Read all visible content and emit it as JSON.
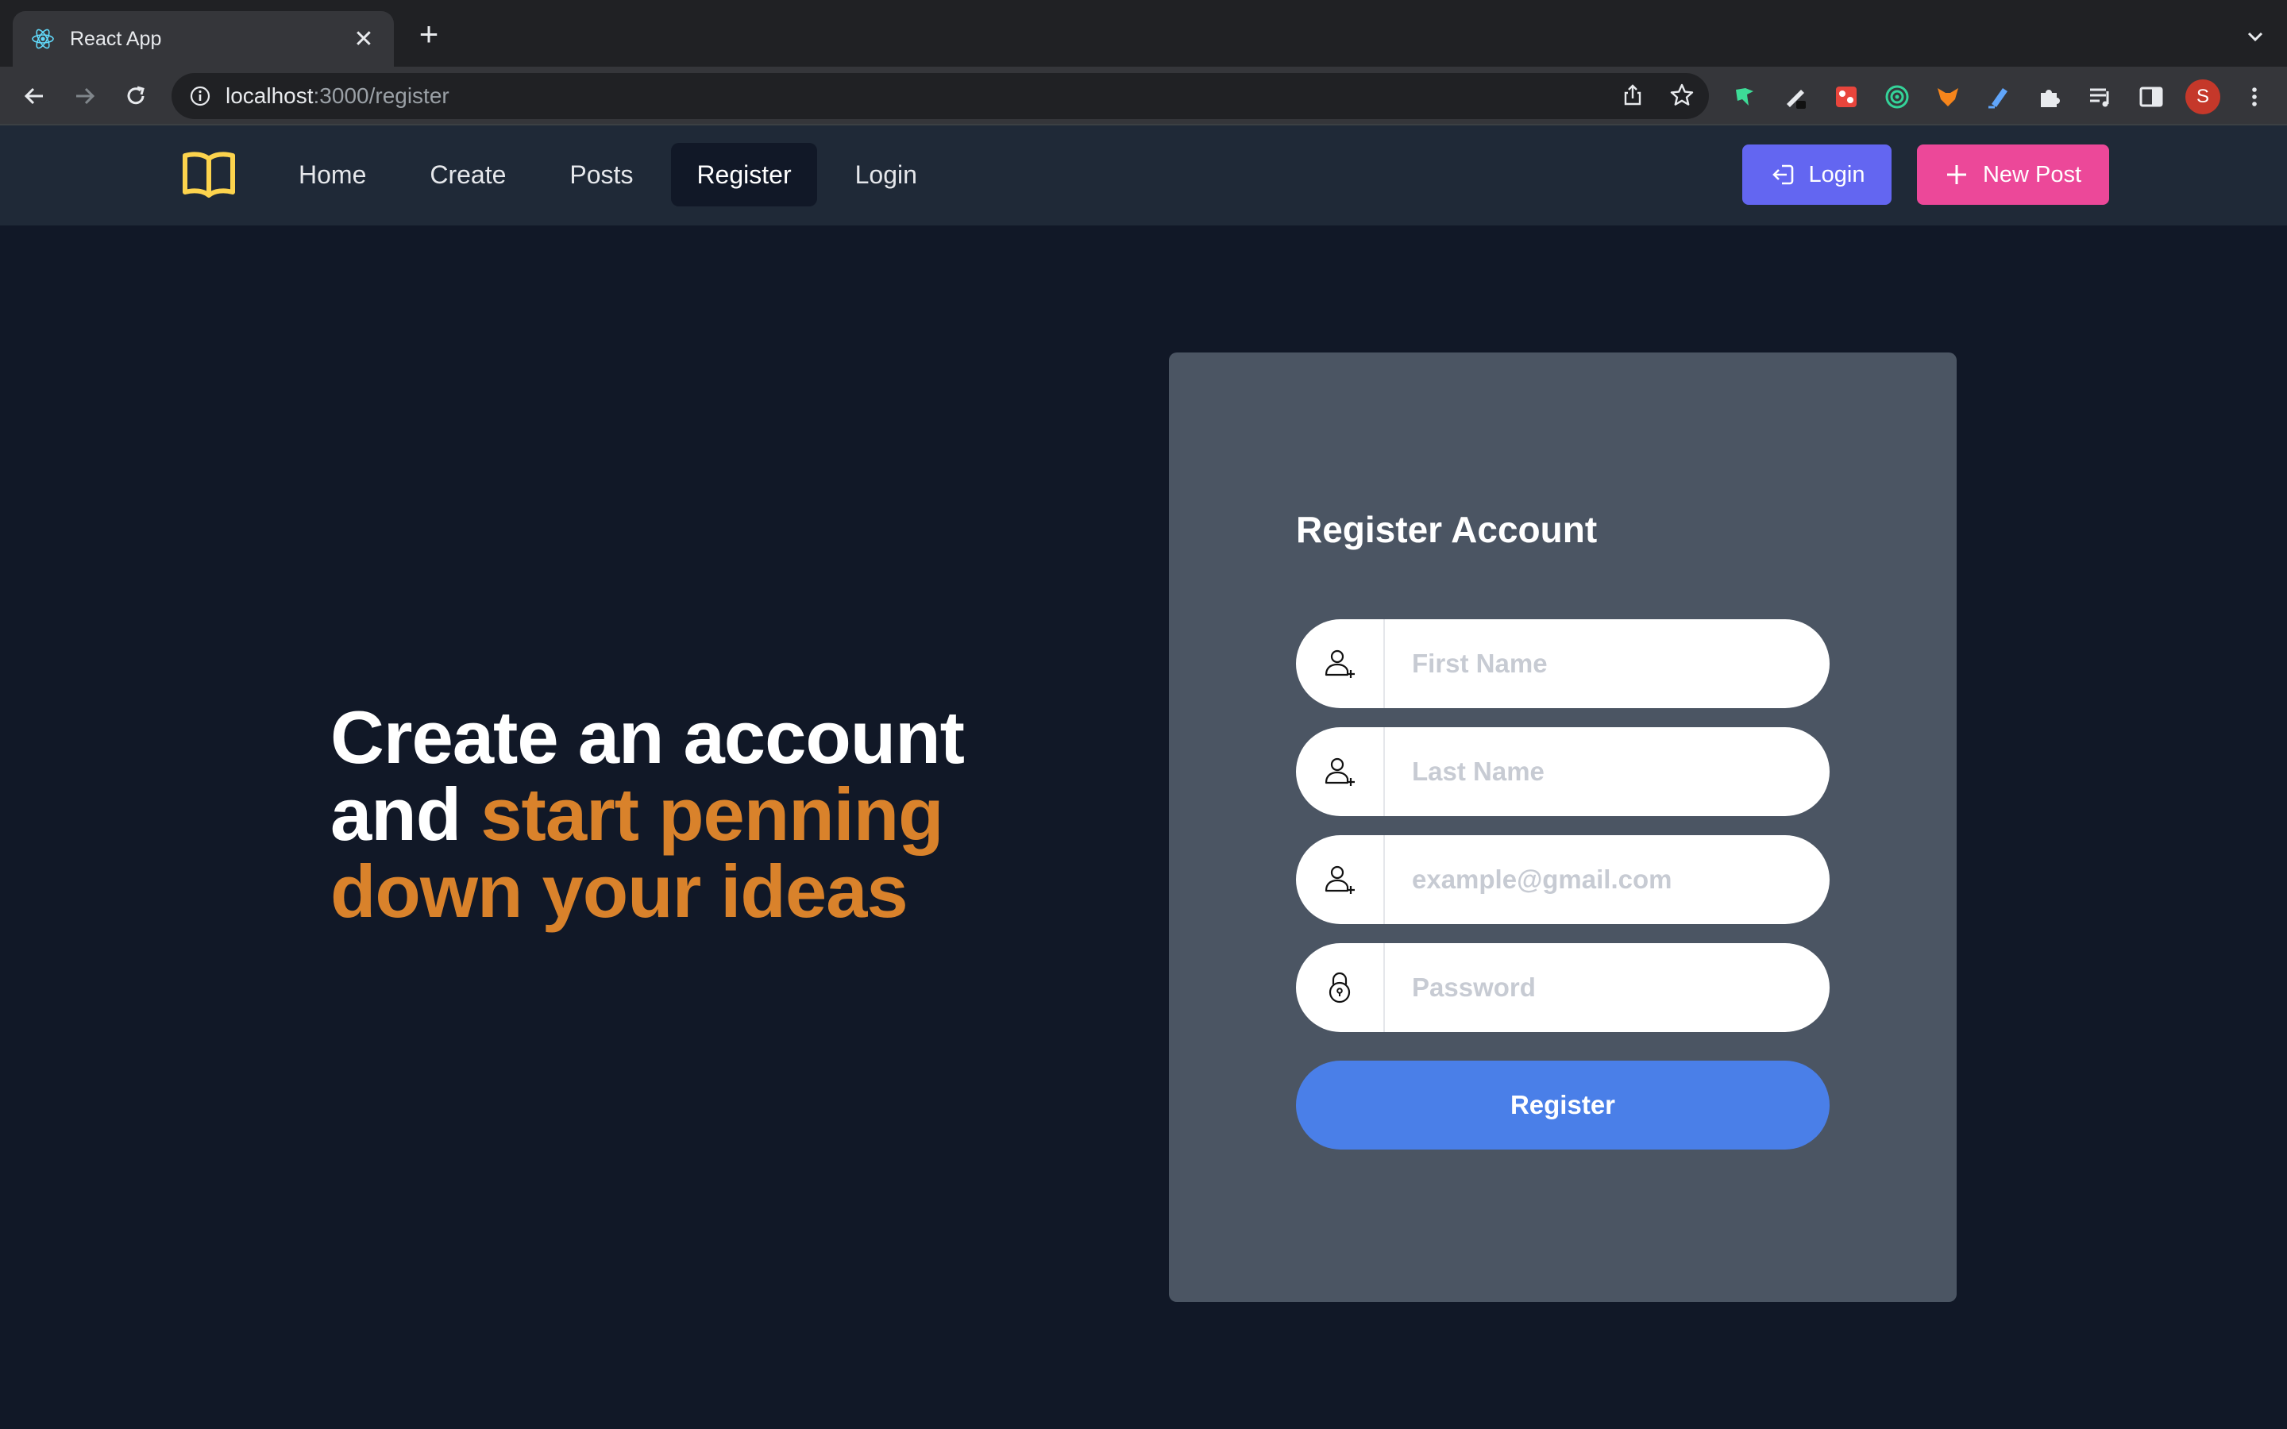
{
  "browser": {
    "tab_title": "React App",
    "url_host": "localhost",
    "url_path": ":3000/register",
    "profile_initial": "S"
  },
  "nav": {
    "links": [
      {
        "label": "Home"
      },
      {
        "label": "Create"
      },
      {
        "label": "Posts"
      },
      {
        "label": "Register",
        "active": true
      },
      {
        "label": "Login"
      }
    ],
    "login_button": "Login",
    "new_post_button": "New Post"
  },
  "hero": {
    "line1": "Create an account",
    "line2_plain": "and ",
    "line2_accent": "start penning",
    "line3_accent": "down your ideas"
  },
  "form": {
    "title": "Register Account",
    "first_name_placeholder": "First Name",
    "last_name_placeholder": "Last Name",
    "email_placeholder": "example@gmail.com",
    "password_placeholder": "Password",
    "submit_label": "Register"
  },
  "colors": {
    "background": "#111827",
    "nav": "#1f2937",
    "card": "#4b5563",
    "accent_text": "#d9822b",
    "login_button": "#6366f1",
    "new_post_button": "#ec4899",
    "register_button": "#4a7fe8"
  }
}
